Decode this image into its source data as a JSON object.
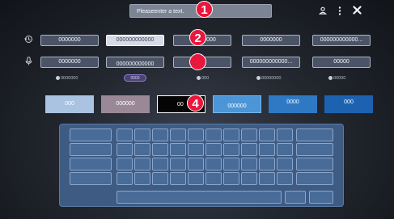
{
  "search": {
    "placeholder": "Pleaseenter a text."
  },
  "header": {
    "user_icon": "user-icon",
    "more_icon": "more-vertical-icon",
    "close_icon": "close-icon"
  },
  "history_row": {
    "icon": "history-icon",
    "items": [
      "0000000",
      "000000000000",
      "0000",
      "0000000",
      "000000000000..."
    ]
  },
  "voice_row": {
    "icon": "microphone-icon",
    "items": [
      "0000000",
      "000000000000",
      "",
      "000000000000...",
      "00000"
    ]
  },
  "recommend_row": {
    "items": [
      "0000000",
      "0000",
      "000",
      "00000000",
      "00000"
    ]
  },
  "swatches": [
    {
      "label": "000",
      "bg": "#a9c3e0",
      "fg": "#ffffff"
    },
    {
      "label": "000000",
      "bg": "#9a8898",
      "fg": "#ffffff"
    },
    {
      "label": "00",
      "bg": "#050505",
      "fg": "#ffffff"
    },
    {
      "label": "000000",
      "bg": "#4c95d6",
      "fg": "#ffffff"
    },
    {
      "label": "0000",
      "bg": "#2f79c4",
      "fg": "#ffffff"
    },
    {
      "label": "000",
      "bg": "#1d62b0",
      "fg": "#ffffff"
    }
  ],
  "badges": [
    "1",
    "2",
    "3",
    "4"
  ],
  "colors": {
    "badge": "#e8173c",
    "keyboard": "#3e5b83"
  }
}
